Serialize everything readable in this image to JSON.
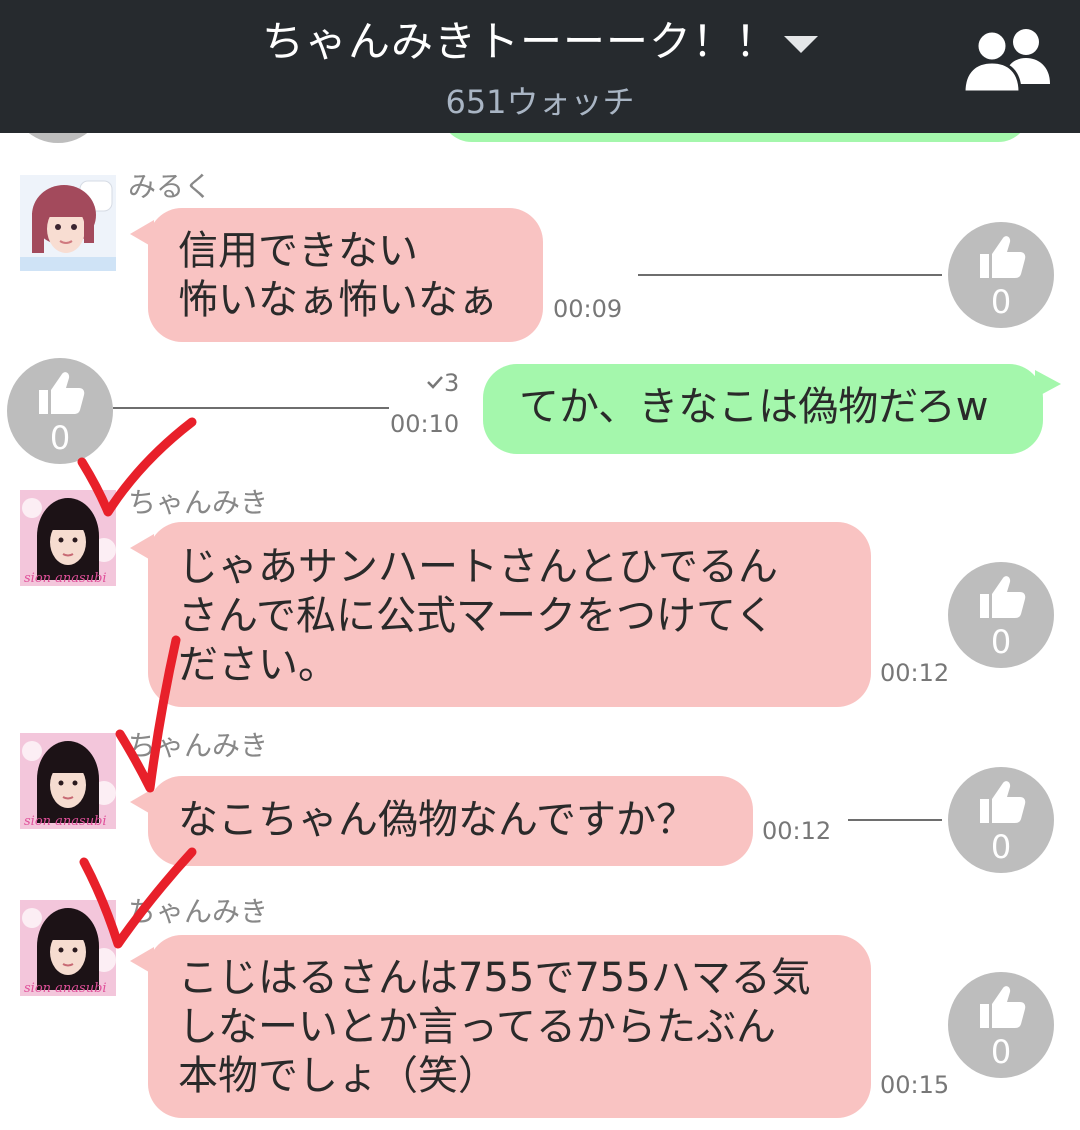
{
  "header": {
    "title": "ちゃんみきトーーーク！！",
    "subtitle": "651ウォッチ",
    "dropdown_icon": "chevron-down-icon",
    "members_icon": "members-icon"
  },
  "colors": {
    "header_bg": "#262a2e",
    "bubble_other": "#f9c3c2",
    "bubble_self": "#a4f7ac",
    "like_circle": "#bdbdbd",
    "annotation_checkmark": "#e8202a"
  },
  "messages": [
    {
      "sender": "みるく",
      "lines": [
        "信用できない",
        "怖いなぁ怖いなぁ"
      ],
      "time": "00:09",
      "likes": "0"
    },
    {
      "self": true,
      "lines": [
        "てか、きなこは偽物だろw"
      ],
      "read": "3",
      "time": "00:10",
      "likes": "0"
    },
    {
      "sender": "ちゃんみき",
      "lines": [
        "じゃあサンハートさんとひでるん",
        "さんで私に公式マークをつけてく",
        "ださい。"
      ],
      "time": "00:12",
      "likes": "0"
    },
    {
      "sender": "ちゃんみき",
      "lines": [
        "なこちゃん偽物なんですか？"
      ],
      "time": "00:12",
      "likes": "0"
    },
    {
      "sender": "ちゃんみき",
      "lines": [
        "こじはるさんは755で755ハマる気",
        "しなーいとか言ってるからたぶん",
        "本物でしょ（笑）"
      ],
      "time": "00:15",
      "likes": "0"
    }
  ],
  "like_icon": "thumbs-up-icon",
  "read_icon": "checkmark-icon"
}
